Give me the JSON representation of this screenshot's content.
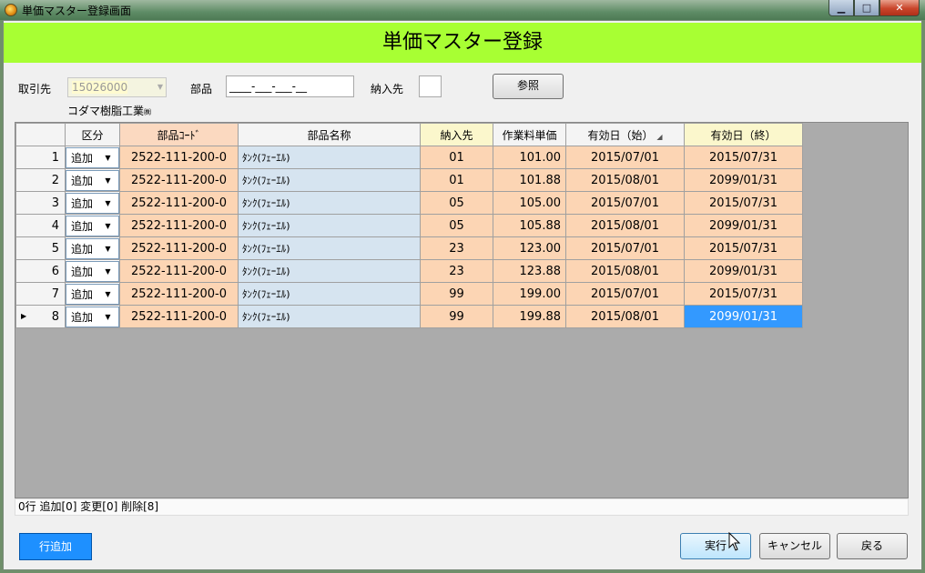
{
  "window": {
    "title": "単価マスター登録画面"
  },
  "header": {
    "title": "単価マスター登録"
  },
  "filters": {
    "customer_label": "取引先",
    "customer_value": "15026000",
    "customer_name": "コダマ樹脂工業",
    "customer_suffix": "㈱",
    "part_label": "部品",
    "part_value": "____-___-___-__",
    "dest_label": "納入先",
    "dest_value": "",
    "ref_button": "参照"
  },
  "grid": {
    "columns": [
      "区分",
      "部品ｺｰﾄﾞ",
      "部品名称",
      "納入先",
      "作業料単価",
      "有効日（始）",
      "有効日（終）"
    ],
    "rows": [
      {
        "no": "1",
        "kubun": "追加",
        "code": "2522-111-200-0",
        "name": "ﾀﾝｸ(ﾌｪｰｴﾙ)",
        "dest": "01",
        "price": "101.00",
        "start": "2015/07/01",
        "end": "2015/07/31"
      },
      {
        "no": "2",
        "kubun": "追加",
        "code": "2522-111-200-0",
        "name": "ﾀﾝｸ(ﾌｪｰｴﾙ)",
        "dest": "01",
        "price": "101.88",
        "start": "2015/08/01",
        "end": "2099/01/31"
      },
      {
        "no": "3",
        "kubun": "追加",
        "code": "2522-111-200-0",
        "name": "ﾀﾝｸ(ﾌｪｰｴﾙ)",
        "dest": "05",
        "price": "105.00",
        "start": "2015/07/01",
        "end": "2015/07/31"
      },
      {
        "no": "4",
        "kubun": "追加",
        "code": "2522-111-200-0",
        "name": "ﾀﾝｸ(ﾌｪｰｴﾙ)",
        "dest": "05",
        "price": "105.88",
        "start": "2015/08/01",
        "end": "2099/01/31"
      },
      {
        "no": "5",
        "kubun": "追加",
        "code": "2522-111-200-0",
        "name": "ﾀﾝｸ(ﾌｪｰｴﾙ)",
        "dest": "23",
        "price": "123.00",
        "start": "2015/07/01",
        "end": "2015/07/31"
      },
      {
        "no": "6",
        "kubun": "追加",
        "code": "2522-111-200-0",
        "name": "ﾀﾝｸ(ﾌｪｰｴﾙ)",
        "dest": "23",
        "price": "123.88",
        "start": "2015/08/01",
        "end": "2099/01/31"
      },
      {
        "no": "7",
        "kubun": "追加",
        "code": "2522-111-200-0",
        "name": "ﾀﾝｸ(ﾌｪｰｴﾙ)",
        "dest": "99",
        "price": "199.00",
        "start": "2015/07/01",
        "end": "2015/07/31"
      },
      {
        "no": "8",
        "kubun": "追加",
        "code": "2522-111-200-0",
        "name": "ﾀﾝｸ(ﾌｪｰｴﾙ)",
        "dest": "99",
        "price": "199.88",
        "start": "2015/08/01",
        "end": "2099/01/31"
      }
    ]
  },
  "status": {
    "text": "0行  追加[0]  変更[0]  削除[8]"
  },
  "buttons": {
    "add_row": "行追加",
    "execute": "実行",
    "cancel": "キャンセル",
    "back": "戻る"
  },
  "colors": {
    "header_bg": "#a8ff33",
    "row_pink": "#fcd5b4",
    "row_blue": "#d6e4f0",
    "selection": "#3399ff",
    "add_row_button": "#1e90ff"
  },
  "icons": {
    "app": "app-icon",
    "minimize": "minimize-icon",
    "maximize": "maximize-icon",
    "close": "close-icon",
    "current_row": "row-pointer-icon",
    "mouse": "mouse-cursor-icon"
  }
}
